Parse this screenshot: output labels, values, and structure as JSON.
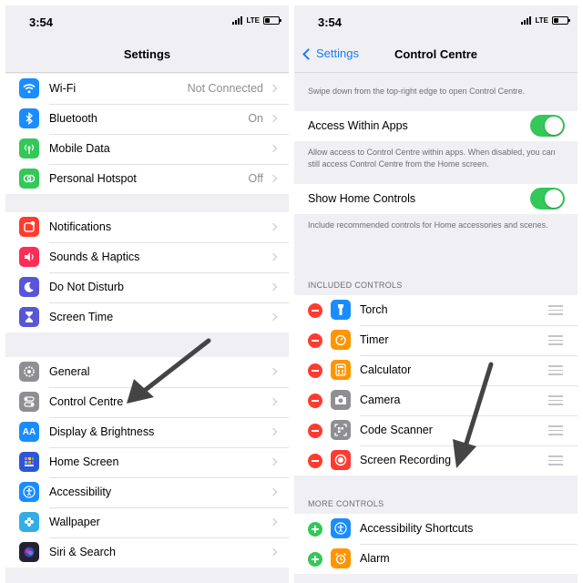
{
  "left_phone": {
    "status": {
      "time": "3:54",
      "network": "LTE"
    },
    "title": "Settings",
    "group1": [
      {
        "label": "Wi-Fi",
        "value": "Not Connected",
        "icon": "wifi-icon",
        "color": "#1a8cff"
      },
      {
        "label": "Bluetooth",
        "value": "On",
        "icon": "bluetooth-icon",
        "color": "#1a8cff"
      },
      {
        "label": "Mobile Data",
        "value": "",
        "icon": "antenna-icon",
        "color": "#34c759"
      },
      {
        "label": "Personal Hotspot",
        "value": "Off",
        "icon": "hotspot-icon",
        "color": "#34c759"
      }
    ],
    "group2": [
      {
        "label": "Notifications",
        "icon": "notifications-icon",
        "color": "#ff3b30"
      },
      {
        "label": "Sounds & Haptics",
        "icon": "speaker-icon",
        "color": "#ff2d55"
      },
      {
        "label": "Do Not Disturb",
        "icon": "moon-icon",
        "color": "#5856d6"
      },
      {
        "label": "Screen Time",
        "icon": "hourglass-icon",
        "color": "#5856d6"
      }
    ],
    "group3": [
      {
        "label": "General",
        "icon": "gear-icon",
        "color": "#8e8e93"
      },
      {
        "label": "Control Centre",
        "icon": "switches-icon",
        "color": "#8e8e93"
      },
      {
        "label": "Display & Brightness",
        "icon": "text-size-icon",
        "color": "#1a8cff",
        "glyph": "AA"
      },
      {
        "label": "Home Screen",
        "icon": "home-grid-icon",
        "color": "#2f55d4"
      },
      {
        "label": "Accessibility",
        "icon": "accessibility-icon",
        "color": "#1a8cff"
      },
      {
        "label": "Wallpaper",
        "icon": "flower-icon",
        "color": "#32ade6"
      },
      {
        "label": "Siri & Search",
        "icon": "siri-icon",
        "color": "#222233"
      }
    ]
  },
  "right_phone": {
    "status": {
      "time": "3:54",
      "network": "LTE"
    },
    "back_label": "Settings",
    "title": "Control Centre",
    "intro": "Swipe down from the top-right edge to open Control Centre.",
    "access_within_apps": {
      "label": "Access Within Apps",
      "on": true,
      "footer": "Allow access to Control Centre within apps. When disabled, you can still access Control Centre from the Home screen."
    },
    "show_home_controls": {
      "label": "Show Home Controls",
      "on": true,
      "footer": "Include recommended controls for Home accessories and scenes."
    },
    "included_header": "INCLUDED CONTROLS",
    "included": [
      {
        "label": "Torch",
        "icon": "torch-icon",
        "color": "#1a8cff"
      },
      {
        "label": "Timer",
        "icon": "timer-icon",
        "color": "#ff9500"
      },
      {
        "label": "Calculator",
        "icon": "calculator-icon",
        "color": "#ff9500"
      },
      {
        "label": "Camera",
        "icon": "camera-icon",
        "color": "#8e8e93"
      },
      {
        "label": "Code Scanner",
        "icon": "qr-scanner-icon",
        "color": "#8e8e93"
      },
      {
        "label": "Screen Recording",
        "icon": "record-icon",
        "color": "#ff3b30"
      }
    ],
    "more_header": "MORE CONTROLS",
    "more": [
      {
        "label": "Accessibility Shortcuts",
        "icon": "accessibility-icon",
        "color": "#1a8cff"
      },
      {
        "label": "Alarm",
        "icon": "alarm-icon",
        "color": "#ff9500"
      }
    ]
  }
}
